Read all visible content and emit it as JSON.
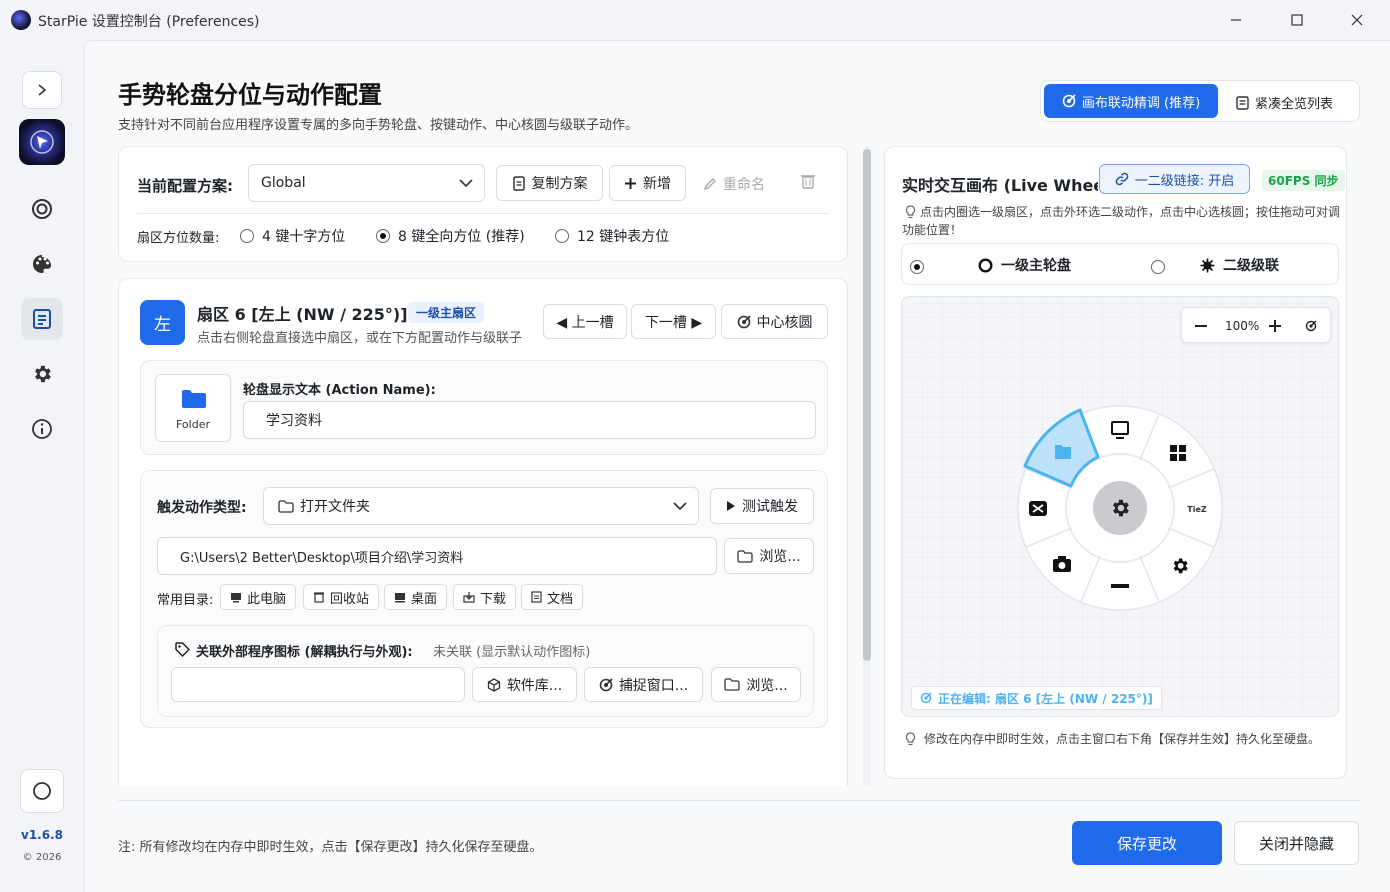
{
  "window": {
    "title": "StarPie 设置控制台 (Preferences)"
  },
  "sidebar": {
    "version": "v1.6.8",
    "copyright": "© 2026"
  },
  "header": {
    "title": "手势轮盘分位与动作配置",
    "subtitle": "支持针对不同前台应用程序设置专属的多向手势轮盘、按键动作、中心核圆与级联子动作。",
    "view_tabs": [
      {
        "label": "画布联动精调 (推荐)",
        "active": true
      },
      {
        "label": "紧凑全览列表",
        "active": false
      }
    ]
  },
  "profile": {
    "label": "当前配置方案:",
    "selected": "Global",
    "copy_label": "复制方案",
    "new_label": "新增",
    "rename_label": "重命名",
    "sector_count_label": "扇区方位数量:",
    "sector_options": [
      {
        "label": "4 键十字方位",
        "selected": false
      },
      {
        "label": "8 键全向方位 (推荐)",
        "selected": true
      },
      {
        "label": "12 键钟表方位",
        "selected": false
      }
    ]
  },
  "sector": {
    "badge": "左",
    "title": "扇区 6 [左上 (NW / 225°)]",
    "tag": "一级主扇区",
    "hint": "点击右侧轮盘直接选中扇区，或在下方配置动作与级联子",
    "prev_label": "◀ 上一槽",
    "next_label": "下一槽 ▶",
    "center_label": "中心核圆",
    "icon_caption": "Folder",
    "name_label": "轮盘显示文本 (Action Name):",
    "name_value": "学习资料",
    "action_type_label": "触发动作类型:",
    "action_type_value": "打开文件夹",
    "test_label": "测试触发",
    "path_value": "G:\\Users\\2 Better\\Desktop\\项目介绍\\学习资料",
    "browse_label": "浏览...",
    "common_dirs_label": "常用目录:",
    "common_dirs": [
      "此电脑",
      "回收站",
      "桌面",
      "下载",
      "文档"
    ],
    "link_label": "关联外部程序图标 (解耦执行与外观):",
    "link_status": "未关联 (显示默认动作图标)",
    "lib_label": "软件库...",
    "capture_label": "捕捉窗口...",
    "browse2_label": "浏览..."
  },
  "canvas": {
    "title": "实时交互画布 (Live Wheel",
    "link_badge": "一二级链接: 开启",
    "fps_badge": "60FPS 同步",
    "hint": "点击内圈选一级扇区，点击外环选二级动作，点击中心选核圆；按住拖动可对调功能位置！",
    "level_options": [
      {
        "label": "一级主轮盘",
        "selected": true
      },
      {
        "label": "二级级联",
        "selected": false
      }
    ],
    "zoom": "100%",
    "editing_label": "正在编辑: 扇区 6 [左上 (NW / 225°)]",
    "wheel_tiez": "TieZ",
    "footer_note": "修改在内存中即时生效，点击主窗口右下角【保存并生效】持久化至硬盘。"
  },
  "footer": {
    "note": "注: 所有修改均在内存中即时生效，点击【保存更改】持久化保存至硬盘。",
    "save_label": "保存更改",
    "close_label": "关闭并隐藏"
  },
  "colors": {
    "accent": "#1e6ae8",
    "highlight": "#4ab3f0",
    "fps": "#16a34a"
  }
}
